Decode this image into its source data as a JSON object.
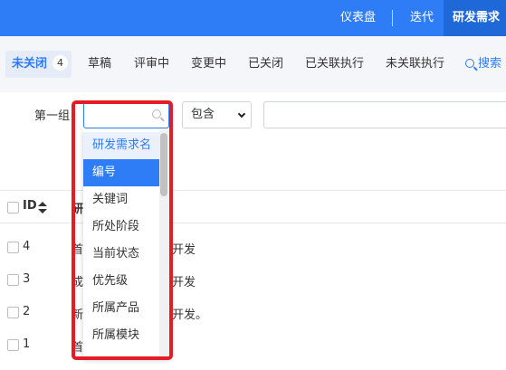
{
  "topnav": {
    "dashboard": "仪表盘",
    "iteration": "迭代",
    "active": "研发需求"
  },
  "tabs": {
    "unclosed": "未关闭",
    "unclosed_count": "4",
    "draft": "草稿",
    "reviewing": "评审中",
    "changing": "变更中",
    "closed": "已关闭",
    "linked_exec": "已关联执行",
    "unlinked_exec": "未关联执行",
    "search": "搜索"
  },
  "search_form": {
    "group_label": "第一组",
    "field_value": "",
    "operator": "包含",
    "value": ""
  },
  "dropdown": {
    "items": [
      "研发需求名",
      "编号",
      "关键词",
      "所处阶段",
      "当前状态",
      "优先级",
      "所属产品",
      "所属模块"
    ],
    "highlighted": "编号"
  },
  "table": {
    "headers": {
      "id": "ID",
      "name_partial": "研"
    },
    "rows": [
      {
        "id": "4",
        "name_partial": "首",
        "tail": "开发"
      },
      {
        "id": "3",
        "name_partial": "成",
        "tail": "开发"
      },
      {
        "id": "2",
        "name_partial": "新",
        "tail": "开发。"
      },
      {
        "id": "1",
        "name_partial": "首",
        "tail": ""
      }
    ]
  },
  "colors": {
    "brand_blue": "#2e7cf6",
    "highlight_red": "#e51c28"
  }
}
